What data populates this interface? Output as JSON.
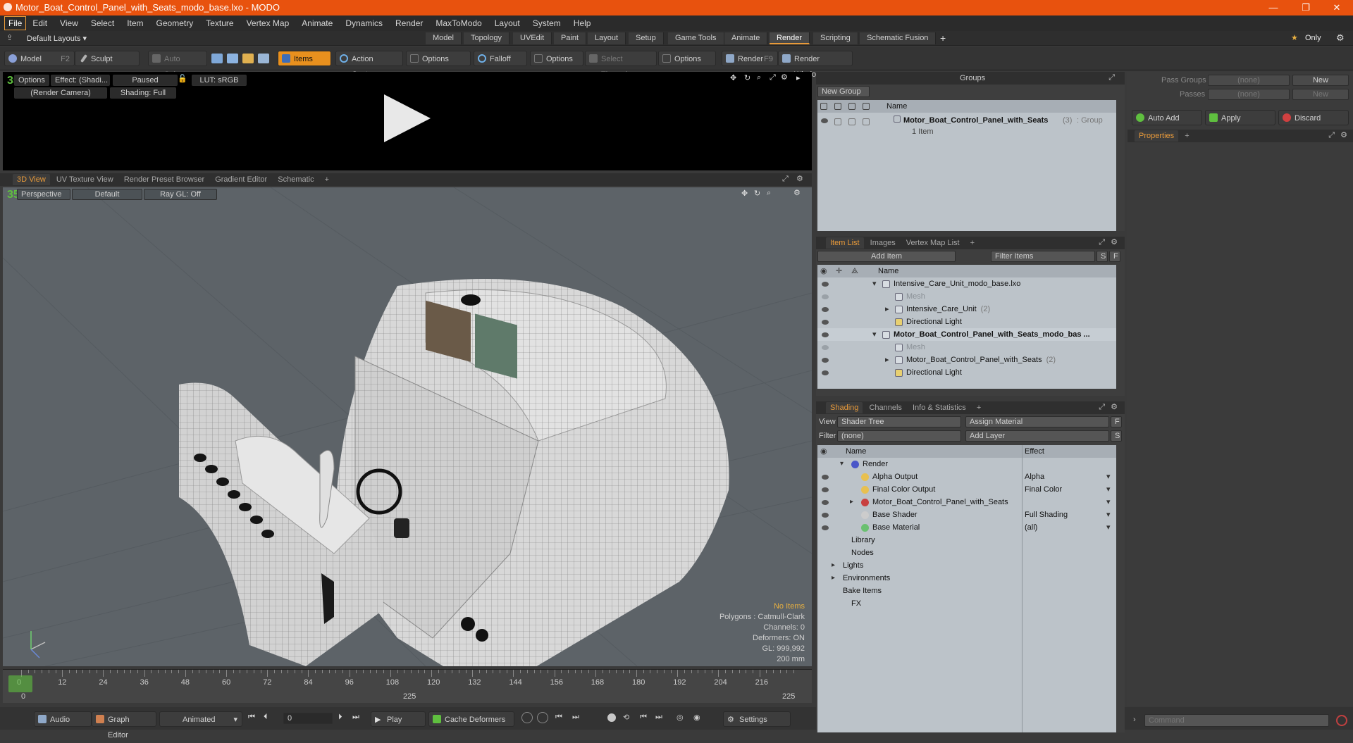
{
  "window": {
    "title": "Motor_Boat_Control_Panel_with_Seats_modo_base.lxo - MODO",
    "controls": [
      "—",
      "❐",
      "✕"
    ]
  },
  "menu": [
    "File",
    "Edit",
    "View",
    "Select",
    "Item",
    "Geometry",
    "Texture",
    "Vertex Map",
    "Animate",
    "Dynamics",
    "Render",
    "MaxToModo",
    "Layout",
    "System",
    "Help"
  ],
  "layouts": {
    "label": "Default Layouts ▾",
    "tabs": [
      "Model",
      "Topology",
      "UVEdit",
      "Paint",
      "Layout",
      "Setup",
      "Game Tools",
      "Animate",
      "Render",
      "Scripting",
      "Schematic Fusion"
    ],
    "selected": "Render",
    "only_label": "Only"
  },
  "toolbar": {
    "model": "Model",
    "model_key": "F2",
    "sculpt": "Sculpt",
    "auto_select": "Auto Select",
    "items": "Items",
    "action_center": "Action Center",
    "options1": "Options",
    "falloff": "Falloff",
    "options2": "Options",
    "select_through": "Select Through",
    "options3": "Options",
    "render": "Render",
    "render_key": "F9",
    "render_window": "Render Window"
  },
  "render_preview": {
    "options": "Options",
    "effect": "Effect: (Shadi...",
    "paused": "Paused",
    "lut": "LUT: sRGB",
    "camera": "(Render Camera)",
    "shading": "Shading: Full"
  },
  "viewport_tabs": [
    "3D View",
    "UV Texture View",
    "Render Preset Browser",
    "Gradient Editor",
    "Schematic"
  ],
  "viewport": {
    "perspective": "Perspective",
    "default": "Default",
    "raygl": "Ray GL: Off",
    "hud": {
      "no_items": "No Items",
      "polygons": "Polygons : Catmull-Clark",
      "channels": "Channels: 0",
      "deformers": "Deformers: ON",
      "gl": "GL: 999,992",
      "scale": "200 mm"
    }
  },
  "timeline": {
    "ticks": [
      "0",
      "12",
      "24",
      "36",
      "48",
      "60",
      "72",
      "84",
      "96",
      "108",
      "120",
      "132",
      "144",
      "156",
      "168",
      "180",
      "192",
      "204",
      "216"
    ],
    "lower_left": "0",
    "lower_mid": "225",
    "lower_right": "225"
  },
  "bottombar": {
    "audio": "Audio",
    "graph_editor": "Graph Editor",
    "animated": "Animated",
    "frame": "0",
    "play": "Play",
    "cache_deformers": "Cache Deformers",
    "settings": "Settings"
  },
  "groups": {
    "title": "Groups",
    "new_group": "New Group",
    "col_name": "Name",
    "item_name": "Motor_Boat_Control_Panel_with_Seats",
    "item_count": "(3)",
    "item_type": ": Group",
    "item_sub": "1 Item"
  },
  "pass": {
    "pass_groups": "Pass Groups",
    "passes": "Passes",
    "none": "(none)",
    "new": "New",
    "auto_add": "Auto Add",
    "apply": "Apply",
    "discard": "Discard",
    "properties": "Properties"
  },
  "itemlist": {
    "tabs": [
      "Item List",
      "Images",
      "Vertex Map List"
    ],
    "add_item": "Add Item",
    "filter_items": "Filter Items",
    "col_name": "Name",
    "rows": [
      {
        "label": "Intensive_Care_Unit_modo_base.lxo",
        "bold": false
      },
      {
        "label": "Mesh",
        "dim": true
      },
      {
        "label": "Intensive_Care_Unit",
        "count": "(2)"
      },
      {
        "label": "Directional Light"
      },
      {
        "label": "Motor_Boat_Control_Panel_with_Seats_modo_bas ...",
        "bold": true
      },
      {
        "label": "Mesh",
        "dim": true
      },
      {
        "label": "Motor_Boat_Control_Panel_with_Seats",
        "count": "(2)"
      },
      {
        "label": "Directional Light"
      }
    ]
  },
  "shading": {
    "tabs": [
      "Shading",
      "Channels",
      "Info & Statistics"
    ],
    "view_label": "View",
    "view_value": "Shader Tree",
    "assign_material": "Assign Material",
    "filter_label": "Filter",
    "filter_value": "(none)",
    "add_layer": "Add Layer",
    "col_name": "Name",
    "col_effect": "Effect",
    "rows": [
      {
        "label": "Render",
        "effect": ""
      },
      {
        "label": "Alpha Output",
        "effect": "Alpha"
      },
      {
        "label": "Final Color Output",
        "effect": "Final Color"
      },
      {
        "label": "Motor_Boat_Control_Panel_with_Seats",
        "effect": ""
      },
      {
        "label": "Base Shader",
        "effect": "Full Shading"
      },
      {
        "label": "Base Material",
        "effect": "(all)"
      },
      {
        "label": "Library",
        "effect": ""
      },
      {
        "label": "Nodes",
        "effect": ""
      },
      {
        "label": "Lights",
        "effect": ""
      },
      {
        "label": "Environments",
        "effect": ""
      },
      {
        "label": "Bake Items",
        "effect": ""
      },
      {
        "label": "FX",
        "effect": ""
      }
    ]
  },
  "command": {
    "placeholder": "Command"
  },
  "colors": {
    "accent": "#e89a3a",
    "titlebar": "#e8520e",
    "tree_bg": "#bcc3c9"
  }
}
